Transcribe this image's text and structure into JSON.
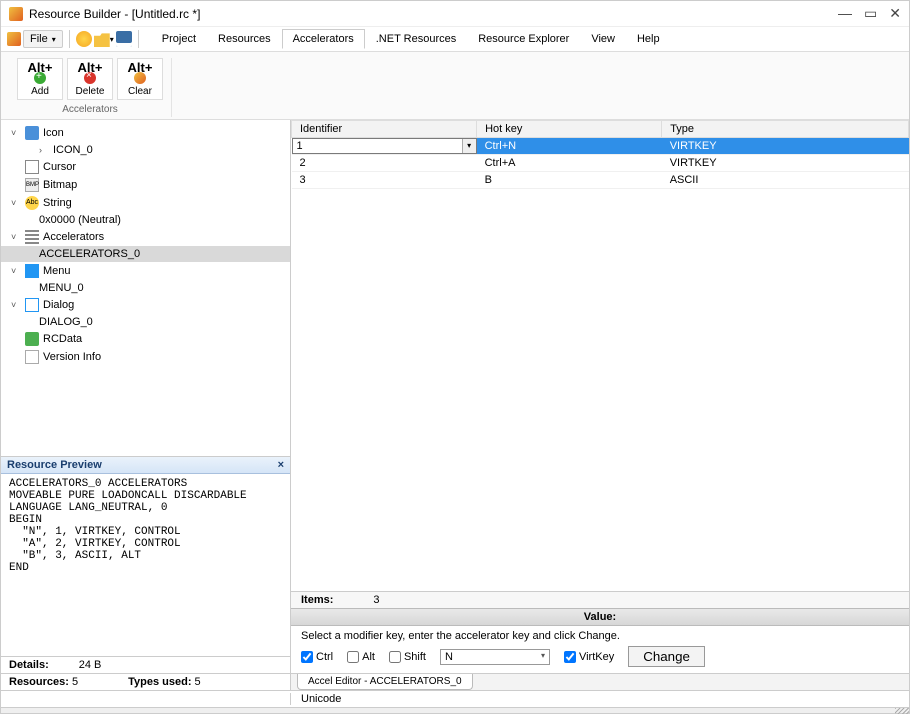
{
  "title": "Resource Builder - [Untitled.rc *]",
  "menu": {
    "file": "File",
    "view": "View",
    "help": "Help"
  },
  "tabs": {
    "project": "Project",
    "resources": "Resources",
    "accelerators": "Accelerators",
    "dotnet": ".NET Resources",
    "explorer": "Resource Explorer"
  },
  "ribbon": {
    "add": "Add",
    "delete": "Delete",
    "clear": "Clear",
    "alt": "Alt+",
    "group": "Accelerators"
  },
  "tree": {
    "icon": "Icon",
    "icon0": "ICON_0",
    "cursor": "Cursor",
    "bitmap": "Bitmap",
    "string": "String",
    "string0": "0x0000 (Neutral)",
    "accel": "Accelerators",
    "accel0": "ACCELERATORS_0",
    "menu": "Menu",
    "menu0": "MENU_0",
    "dialog": "Dialog",
    "dialog0": "DIALOG_0",
    "rcdata": "RCData",
    "version": "Version Info"
  },
  "preview": {
    "title": "Resource Preview",
    "body": "ACCELERATORS_0 ACCELERATORS\nMOVEABLE PURE LOADONCALL DISCARDABLE\nLANGUAGE LANG_NEUTRAL, 0\nBEGIN\n  \"N\", 1, VIRTKEY, CONTROL\n  \"A\", 2, VIRTKEY, CONTROL\n  \"B\", 3, ASCII, ALT\nEND"
  },
  "details": {
    "label": "Details:",
    "value": "24 B"
  },
  "status": {
    "resources_lbl": "Resources:",
    "resources_val": "5",
    "types_lbl": "Types used:",
    "types_val": "5"
  },
  "grid": {
    "cols": {
      "id": "Identifier",
      "hot": "Hot key",
      "type": "Type"
    },
    "editval": "1",
    "r1": {
      "hot": "Ctrl+N",
      "type": "VIRTKEY"
    },
    "r2": {
      "id": "2",
      "hot": "Ctrl+A",
      "type": "VIRTKEY"
    },
    "r3": {
      "id": "3",
      "hot": "B",
      "type": "ASCII"
    }
  },
  "items": {
    "label": "Items:",
    "count": "3"
  },
  "valuehdr": "Value:",
  "instr": "Select a modifier key, enter the accelerator key and click Change.",
  "mods": {
    "ctrl": "Ctrl",
    "alt": "Alt",
    "shift": "Shift",
    "virtkey": "VirtKey",
    "key": "N",
    "change": "Change"
  },
  "tabstrip": "Accel Editor - ACCELERATORS_0",
  "unicode": "Unicode"
}
